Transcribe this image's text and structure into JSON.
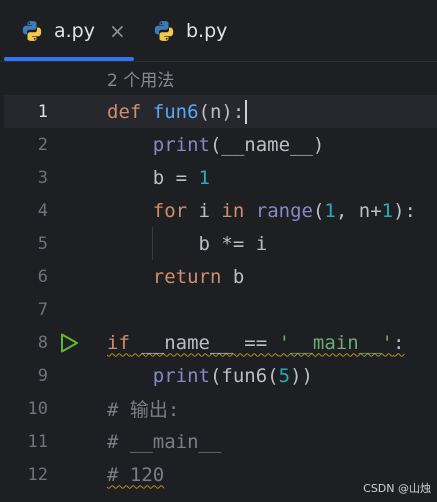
{
  "tabs": [
    {
      "label": "a.py",
      "active": true,
      "close": "×"
    },
    {
      "label": "b.py",
      "active": false
    }
  ],
  "usage_hint": "2 个用法",
  "gutter": {
    "line_numbers": [
      "1",
      "2",
      "3",
      "4",
      "5",
      "6",
      "7",
      "8",
      "9",
      "10",
      "11",
      "12"
    ],
    "current_line": "1",
    "run_line": "8"
  },
  "code": {
    "l1": {
      "kw": "def",
      "fn": "fun6",
      "rest": "(n):"
    },
    "l2": {
      "bi": "print",
      "rest": "(__name__)"
    },
    "l3": {
      "text": "b = ",
      "num": "1"
    },
    "l4": {
      "kw1": "for",
      "mid1": " i ",
      "kw2": "in",
      "sp": " ",
      "bi": "range",
      "p1": "(",
      "n1": "1",
      "p2": ", n+",
      "n2": "1",
      "p3": "):"
    },
    "l5": {
      "text": "b *= i"
    },
    "l6": {
      "kw": "return",
      "rest": " b"
    },
    "l8": {
      "kw": "if",
      "mid": " __name__ == ",
      "str": "'__main__'",
      "end": ":"
    },
    "l9": {
      "bi": "print",
      "p1": "(fun6(",
      "num": "5",
      "p2": "))"
    },
    "l10": {
      "text": "# 输出:"
    },
    "l11": {
      "text": "# __main__"
    },
    "l12": {
      "text": "# 120"
    }
  },
  "watermark": "CSDN @山烛",
  "colors": {
    "accent": "#3574f0",
    "keyword": "#cf8e6d",
    "function": "#56a8f5",
    "number": "#2aacb8",
    "string": "#6aab73",
    "run": "#5fb832"
  }
}
